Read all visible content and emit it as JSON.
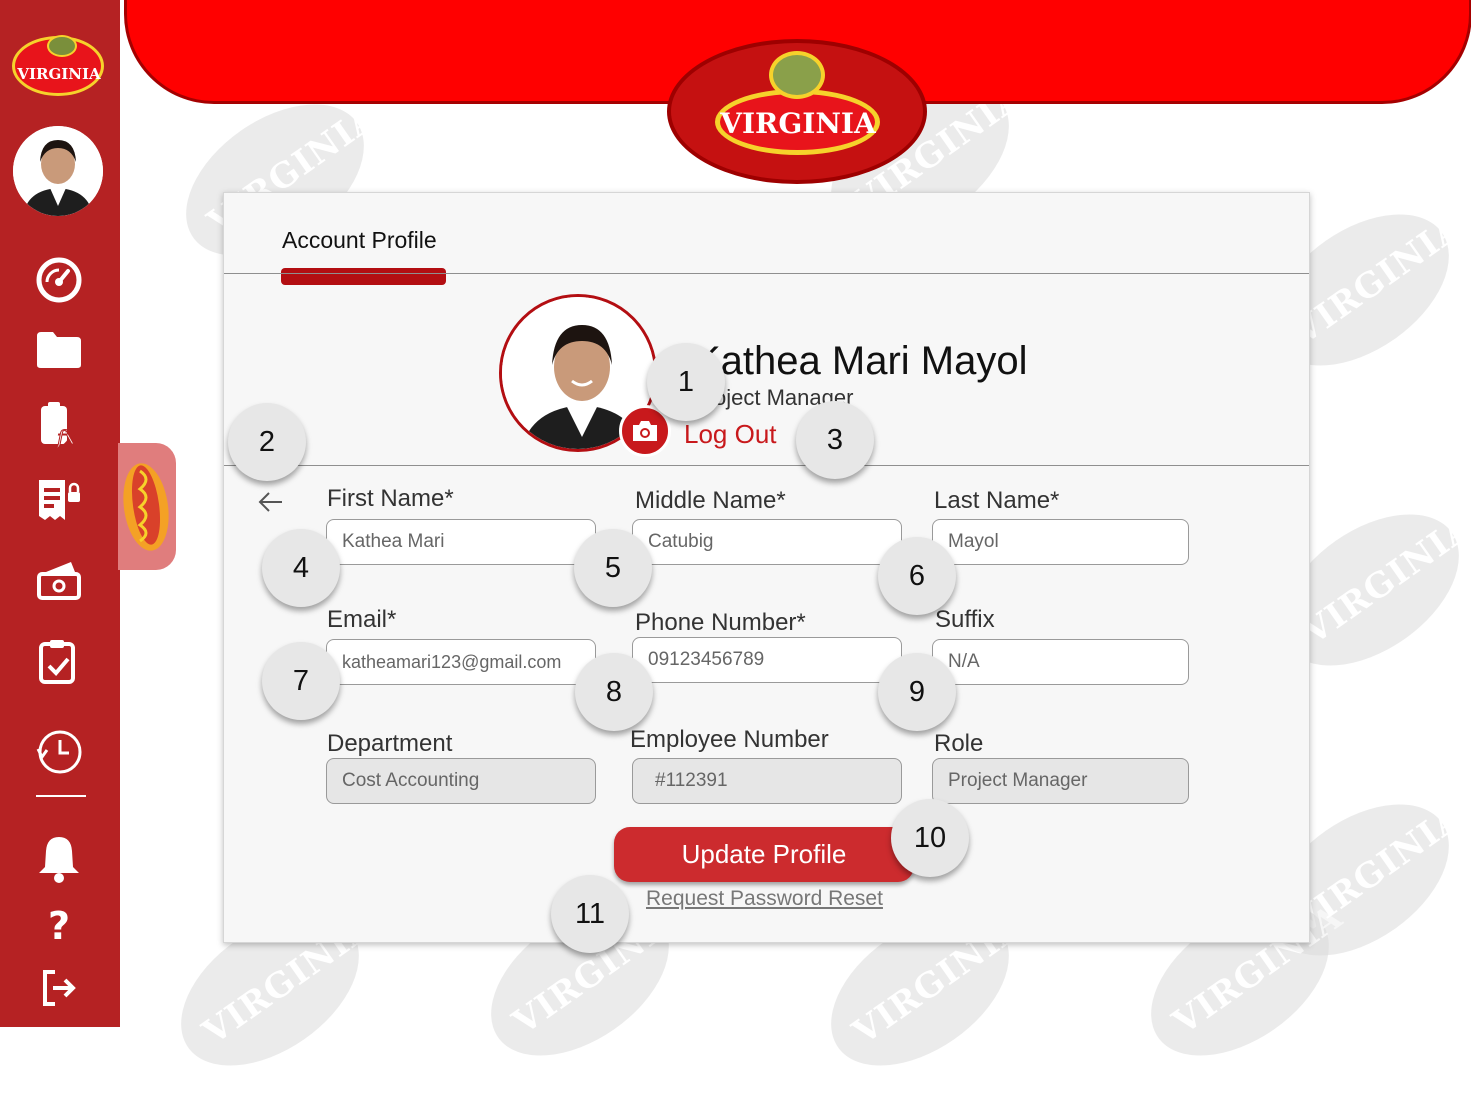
{
  "brand": {
    "logo_text": "VIRGINIA"
  },
  "sidebar": {
    "items": [
      {
        "icon": "dashboard-gauge-icon"
      },
      {
        "icon": "folder-icon"
      },
      {
        "icon": "clipboard-formula-icon"
      },
      {
        "icon": "report-lock-icon"
      },
      {
        "icon": "cash-icon"
      },
      {
        "icon": "task-checklist-icon"
      },
      {
        "icon": "history-clock-icon"
      },
      {
        "icon": "notification-bell-icon"
      },
      {
        "icon": "help-icon",
        "glyph": "?"
      },
      {
        "icon": "logout-icon"
      }
    ],
    "side_tab_icon": "hotdog-icon"
  },
  "card": {
    "tab_title": "Account Profile",
    "full_name": "Kathea Mari Mayol",
    "role_subtitle": "Project Manager",
    "logout_label": "Log Out"
  },
  "form": {
    "first_name": {
      "label": "First Name*",
      "value": "Kathea Mari"
    },
    "middle_name": {
      "label": "Middle Name*",
      "value": "Catubig"
    },
    "last_name": {
      "label": "Last Name*",
      "value": "Mayol"
    },
    "email": {
      "label": "Email*",
      "value": "katheamari123@gmail.com"
    },
    "phone": {
      "label": "Phone Number*",
      "value": "09123456789"
    },
    "suffix": {
      "label": "Suffix",
      "value": "N/A"
    },
    "department": {
      "label": "Department",
      "value": "Cost Accounting"
    },
    "employee_number": {
      "label": "Employee Number",
      "value": "#112391"
    },
    "role": {
      "label": "Role",
      "value": "Project Manager"
    },
    "update_label": "Update Profile",
    "reset_label": "Request Password Reset"
  },
  "markers": [
    "1",
    "2",
    "3",
    "4",
    "5",
    "6",
    "7",
    "8",
    "9",
    "10",
    "11"
  ],
  "colors": {
    "primary_red": "#b52223",
    "banner_red": "#ff0000",
    "accent_yellow": "#f6d22b",
    "button_red": "#cc2b2e"
  }
}
